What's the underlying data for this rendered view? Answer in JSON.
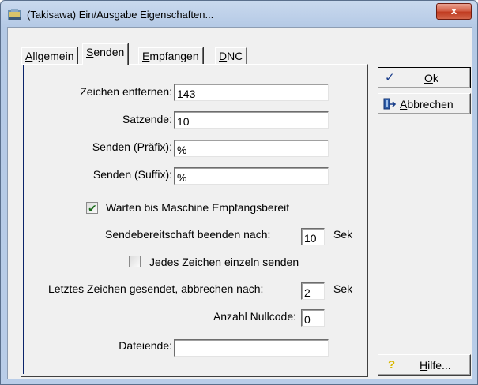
{
  "window": {
    "title": "(Takisawa) Ein/Ausgabe Eigenschaften...",
    "close_label": "x"
  },
  "tabs": [
    {
      "accel": "A",
      "rest": "llgemein",
      "active": false
    },
    {
      "accel": "S",
      "rest": "enden",
      "active": true
    },
    {
      "accel": "E",
      "rest": "mpfangen",
      "active": false
    },
    {
      "accel": "D",
      "rest": "NC",
      "active": false
    }
  ],
  "form": {
    "zeichen_entfernen": {
      "label": "Zeichen entfernen:",
      "value": "143"
    },
    "satzende": {
      "label": "Satzende:",
      "value": "10"
    },
    "senden_praefix": {
      "label": "Senden (Präfix):",
      "value": "%"
    },
    "senden_suffix": {
      "label": "Senden (Suffix):",
      "value": "%"
    },
    "warten_checkbox": {
      "label": "Warten bis Maschine Empfangsbereit",
      "checked": true
    },
    "sendebereitschaft": {
      "label": "Sendebereitschaft beenden nach:",
      "value": "10",
      "unit": "Sek"
    },
    "jedes_zeichen_checkbox": {
      "label": "Jedes Zeichen einzeln senden",
      "checked": false
    },
    "letztes_zeichen": {
      "label": "Letztes Zeichen gesendet, abbrechen nach:",
      "value": "2",
      "unit": "Sek"
    },
    "anzahl_nullcode": {
      "label": "Anzahl Nullcode:",
      "value": "0"
    },
    "dateiende": {
      "label": "Dateiende:",
      "value": ""
    }
  },
  "buttons": {
    "ok": {
      "accel": "O",
      "rest": "k",
      "icon": "checkmark-icon"
    },
    "abbrechen": {
      "accel": "A",
      "rest": "bbrechen",
      "icon": "exit-door-icon"
    },
    "hilfe": {
      "accel": "H",
      "rest": "ilfe...",
      "icon": "question-mark-icon"
    }
  },
  "colors": {
    "dialog_bg": "#f0f0f0",
    "titlebar": "#b9cde8",
    "close_button": "#c8482c",
    "panel_border": "#0a246a"
  }
}
